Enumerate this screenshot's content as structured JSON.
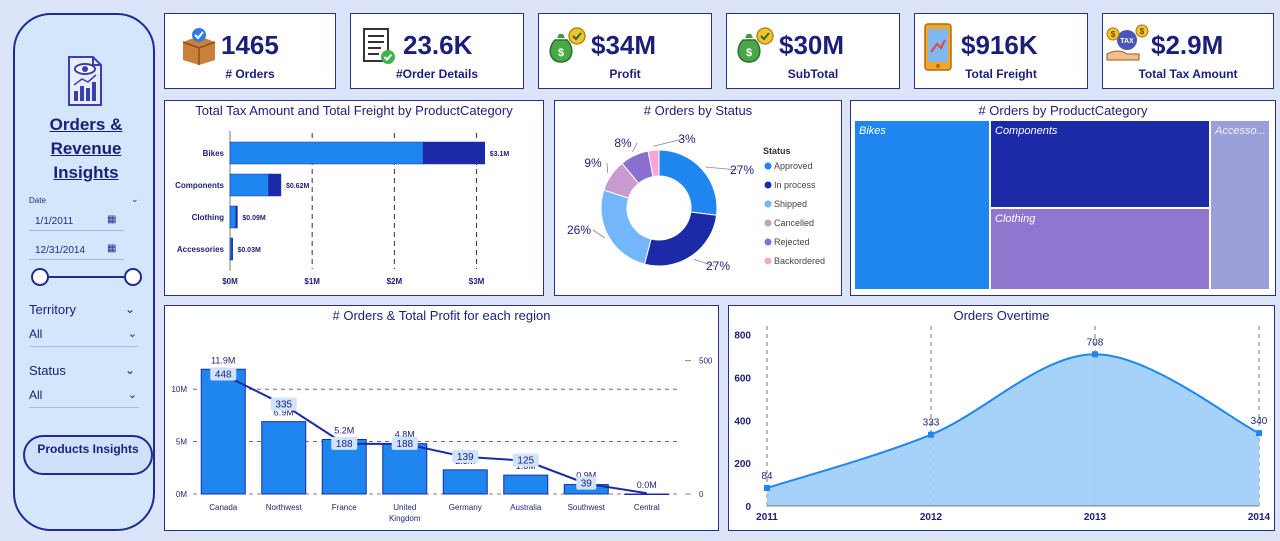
{
  "sidebar": {
    "title_lines": [
      "Orders &",
      "Revenue",
      "Insights"
    ],
    "date_label": "Date",
    "date_start": "1/1/2011",
    "date_end": "12/31/2014",
    "territory_label": "Territory",
    "territory_value": "All",
    "status_label": "Status",
    "status_value": "All",
    "products_button": "Products Insights"
  },
  "kpis": [
    {
      "value": "1465",
      "label": "# Orders",
      "icon": "box-icon"
    },
    {
      "value": "23.6K",
      "label": "#Order Details",
      "icon": "checklist-icon"
    },
    {
      "value": "$34M",
      "label": "Profit",
      "icon": "money-bag-icon"
    },
    {
      "value": "$30M",
      "label": "SubTotal",
      "icon": "money-bag-icon"
    },
    {
      "value": "$916K",
      "label": "Total Freight",
      "icon": "phone-icon"
    },
    {
      "value": "$2.9M",
      "label": "Total Tax Amount",
      "icon": "tax-hand-icon"
    }
  ],
  "panels": {
    "tax_freight_title": "Total Tax Amount and Total Freight by ProductCategory",
    "status_title": "# Orders by Status",
    "category_title": "# Orders by ProductCategory",
    "region_title": "# Orders & Total Profit for each region",
    "overtime_title": "Orders Overtime"
  },
  "colors": {
    "navy": "#1b1f7a",
    "bright_blue": "#1f86f0",
    "dark_blue": "#1c2aa8",
    "light_blue": "#74b6fb",
    "pink": "#f4a6d6",
    "mauve": "#c79ad0",
    "purple": "#8a6fd0",
    "area_fill": "#9ccdf8"
  },
  "chart_data": [
    {
      "type": "bar",
      "title": "Total Tax Amount and Total Freight by ProductCategory",
      "orientation": "horizontal",
      "stacked": true,
      "categories": [
        "Bikes",
        "Components",
        "Clothing",
        "Accessories"
      ],
      "series": [
        {
          "name": "",
          "values": [
            2.35,
            0.47,
            0.07,
            0.02
          ],
          "color": "#1f86f0"
        },
        {
          "name": "",
          "values": [
            0.75,
            0.15,
            0.02,
            0.01
          ],
          "color": "#1c2aa8"
        }
      ],
      "data_labels": [
        "$3.1M",
        "$0.62M",
        "$0.09M",
        "$0.03M"
      ],
      "x_ticks": [
        "$0M",
        "$1M",
        "$2M",
        "$3M"
      ],
      "xlim": [
        0,
        3.2
      ],
      "grid": "vertical dashed"
    },
    {
      "type": "pie",
      "donut": true,
      "title": "# Orders by Status",
      "legend_title": "Status",
      "legend_position": "right",
      "slices": [
        {
          "name": "Approved",
          "value": 27,
          "label": "27%",
          "color": "#1f86f0"
        },
        {
          "name": "In process",
          "value": 27,
          "label": "27%",
          "color": "#1c2aa8"
        },
        {
          "name": "Shipped",
          "value": 26,
          "label": "26%",
          "color": "#74b6fb"
        },
        {
          "name": "Cancelled",
          "value": 9,
          "label": "9%",
          "color": "#c79ad0"
        },
        {
          "name": "Rejected",
          "value": 8,
          "label": "8%",
          "color": "#8a6fd0"
        },
        {
          "name": "Backordered",
          "value": 3,
          "label": "3%",
          "color": "#f4a6d6"
        }
      ]
    },
    {
      "type": "treemap",
      "title": "# Orders by ProductCategory",
      "items": [
        {
          "name": "Bikes",
          "color": "#1f86f0"
        },
        {
          "name": "Components",
          "color": "#1c2aa8"
        },
        {
          "name": "Clothing",
          "color": "#8f77d0"
        },
        {
          "name": "Accesso...",
          "color": "#9a9fd8"
        }
      ]
    },
    {
      "type": "bar",
      "title": "# Orders & Total Profit for each region",
      "categories": [
        "Canada",
        "Northwest",
        "France",
        "United Kingdom",
        "Germany",
        "Australia",
        "Southwest",
        "Central"
      ],
      "series": [
        {
          "name": "",
          "kind": "bar",
          "axis": "left",
          "values": [
            11.9,
            6.9,
            5.2,
            4.8,
            2.3,
            1.8,
            0.9,
            0.0
          ],
          "labels": [
            "11.9M",
            "6.9M",
            "5.2M",
            "4.8M",
            "2.3M",
            "1.8M",
            "0.9M",
            "0.0M"
          ],
          "color": "#1f86f0"
        },
        {
          "name": "",
          "kind": "line",
          "axis": "right",
          "values": [
            448,
            335,
            188,
            188,
            139,
            125,
            39,
            3
          ],
          "labels": [
            "448",
            "335",
            "188",
            "188",
            "139",
            "125",
            "39",
            ""
          ],
          "color": "#1c2aa8"
        }
      ],
      "y_ticks_left": [
        "0M",
        "5M",
        "10M"
      ],
      "ylim_left": [
        0,
        14.5
      ],
      "y_ticks_right": [
        "0",
        "500"
      ],
      "ylim_right": [
        0,
        570
      ],
      "grid": "horizontal dashed"
    },
    {
      "type": "area",
      "title": "Orders Overtime",
      "x": [
        "2011",
        "2012",
        "2013",
        "2014"
      ],
      "values": [
        84,
        333,
        708,
        340
      ],
      "labels": [
        "84",
        "333",
        "708",
        "340"
      ],
      "y_ticks": [
        "0",
        "200",
        "400",
        "600",
        "800"
      ],
      "ylim": [
        0,
        840
      ],
      "color": "#1f86f0",
      "fill": "#9ccdf8",
      "grid": "vertical dashed"
    }
  ]
}
